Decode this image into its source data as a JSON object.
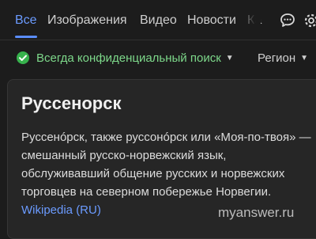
{
  "tabs": [
    {
      "label": "Все",
      "active": true
    },
    {
      "label": "Изображения",
      "active": false
    },
    {
      "label": "Видео",
      "active": false
    },
    {
      "label": "Новости",
      "active": false
    },
    {
      "label": "Ка",
      "active": false
    }
  ],
  "header_icons": [
    "chat-bubble-icon",
    "gear-icon"
  ],
  "filters": {
    "safe_search_label": "Всегда конфиденциальный поиск",
    "region_label": "Регион"
  },
  "card": {
    "title": "Руссенорск",
    "text": "Руссенóрск, также руссонóрск или «Моя-по-твоя» — смешанный русско-норвежский язык, обслуживавший общение русских и норвежских торговцев на северном побережье Норвегии.",
    "source_link": "Wikipedia (RU)"
  },
  "watermark": "myanswer.ru",
  "colors": {
    "accent": "#6b9bff",
    "check": "#37b24d",
    "background": "#1c1c1c",
    "card": "#262626"
  }
}
